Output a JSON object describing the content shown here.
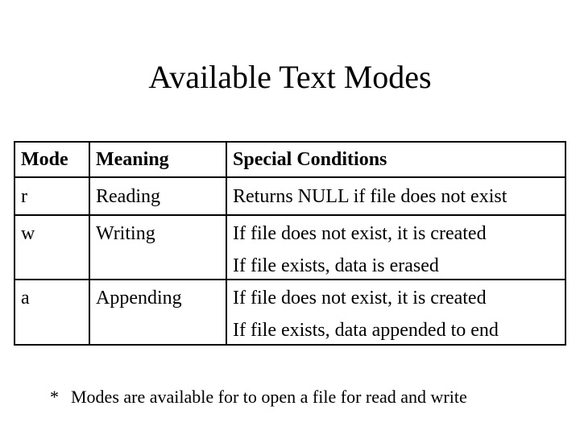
{
  "title": "Available Text Modes",
  "table": {
    "headers": {
      "mode": "Mode",
      "meaning": "Meaning",
      "conditions": "Special Conditions"
    },
    "rows": [
      {
        "mode": "r",
        "meaning": "Reading",
        "conditions": [
          "Returns NULL if file does not exist"
        ]
      },
      {
        "mode": "w",
        "meaning": "Writing",
        "conditions": [
          "If file does not exist, it is created",
          "If file exists, data is erased"
        ]
      },
      {
        "mode": "a",
        "meaning": "Appending",
        "conditions": [
          "If file does not exist, it is created",
          "If file exists, data appended to end"
        ]
      }
    ]
  },
  "footnote": {
    "marker": "*",
    "text": "Modes are available for to open a file for read and write"
  }
}
